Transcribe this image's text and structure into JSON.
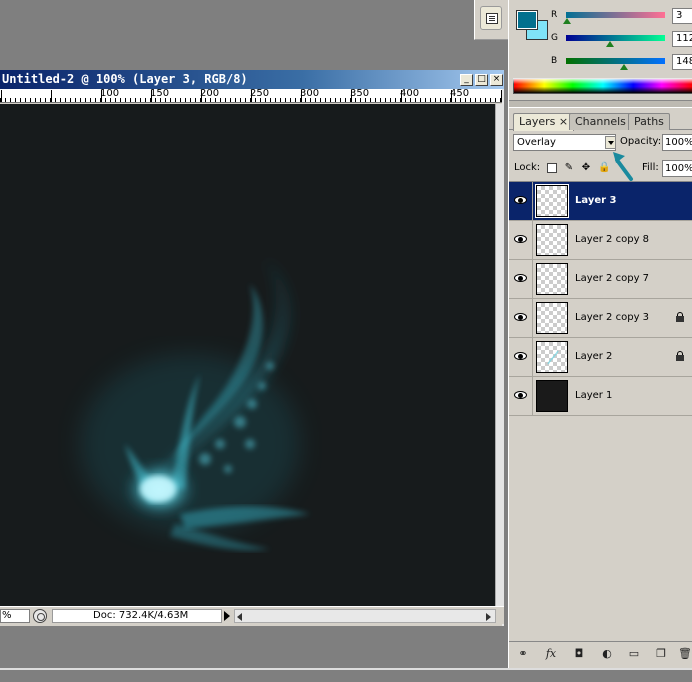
{
  "document": {
    "title": "Untitled-2 @ 100% (Layer 3, RGB/8)",
    "ruler_labels": [
      "100",
      "150",
      "200",
      "250",
      "300",
      "350",
      "400",
      "450"
    ],
    "zoom": "%",
    "doc_info": "Doc: 732.4K/4.63M"
  },
  "color_panel": {
    "foreground": "#03708e",
    "background": "#7fe3f7",
    "channels": [
      {
        "label": "R",
        "value": "3",
        "fraction": 0.01
      },
      {
        "label": "G",
        "value": "112",
        "fraction": 0.44
      },
      {
        "label": "B",
        "value": "148",
        "fraction": 0.58
      }
    ]
  },
  "layers_panel": {
    "tabs": [
      {
        "label": "Layers",
        "close": "×"
      },
      {
        "label": "Channels"
      },
      {
        "label": "Paths"
      }
    ],
    "blend_mode": "Overlay",
    "opacity_label": "Opacity:",
    "opacity": "100%",
    "lock_label": "Lock:",
    "fill_label": "Fill:",
    "fill": "100%",
    "layers": [
      {
        "name": "Layer 3",
        "selected": true,
        "locked": false,
        "thumb": "transparent"
      },
      {
        "name": "Layer 2 copy 8",
        "selected": false,
        "locked": false,
        "thumb": "transparent"
      },
      {
        "name": "Layer 2 copy 7",
        "selected": false,
        "locked": false,
        "thumb": "transparent"
      },
      {
        "name": "Layer 2 copy 3",
        "selected": false,
        "locked": true,
        "thumb": "transparent"
      },
      {
        "name": "Layer 2",
        "selected": false,
        "locked": true,
        "thumb": "transparent"
      },
      {
        "name": "Layer 1",
        "selected": false,
        "locked": false,
        "thumb": "dark"
      }
    ],
    "bottom_icons": [
      "link-icon",
      "fx-icon",
      "mask-icon",
      "adjustment-icon",
      "group-folder-icon",
      "new-layer-icon",
      "trash-icon"
    ]
  },
  "accent_colors": {
    "title_bar": "#0a246a",
    "selection": "#0a246a",
    "arrow": "#1a8a9e",
    "glow": "#5fe4f5"
  }
}
